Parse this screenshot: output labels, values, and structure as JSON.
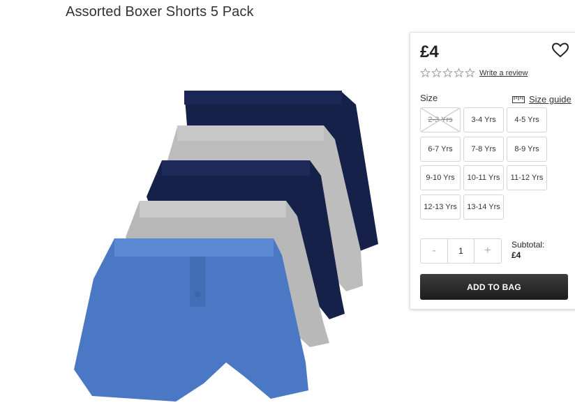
{
  "product": {
    "title": "Assorted Boxer Shorts 5 Pack",
    "price": "£4",
    "rating_stars": 0,
    "write_review_label": "Write a review"
  },
  "size": {
    "label": "Size",
    "guide_label": "Size guide",
    "options": [
      {
        "label": "2-3 Yrs",
        "available": false
      },
      {
        "label": "3-4 Yrs",
        "available": true
      },
      {
        "label": "4-5 Yrs",
        "available": true
      },
      {
        "label": "6-7 Yrs",
        "available": true
      },
      {
        "label": "7-8 Yrs",
        "available": true
      },
      {
        "label": "8-9 Yrs",
        "available": true
      },
      {
        "label": "9-10 Yrs",
        "available": true
      },
      {
        "label": "10-11 Yrs",
        "available": true
      },
      {
        "label": "11-12 Yrs",
        "available": true
      },
      {
        "label": "12-13 Yrs",
        "available": true
      },
      {
        "label": "13-14 Yrs",
        "available": true
      }
    ]
  },
  "quantity": {
    "minus": "-",
    "value": "1",
    "plus": "+"
  },
  "subtotal": {
    "label": "Subtotal:",
    "value": "£4"
  },
  "add_to_bag_label": "ADD TO BAG",
  "colors": {
    "navy": "#16214a",
    "grey": "#c2c2c2",
    "blue": "#4a78c4",
    "button": "#262626"
  },
  "icons": {
    "wishlist": "heart-icon",
    "size_guide": "ruler-icon",
    "rating": "star-icon"
  }
}
